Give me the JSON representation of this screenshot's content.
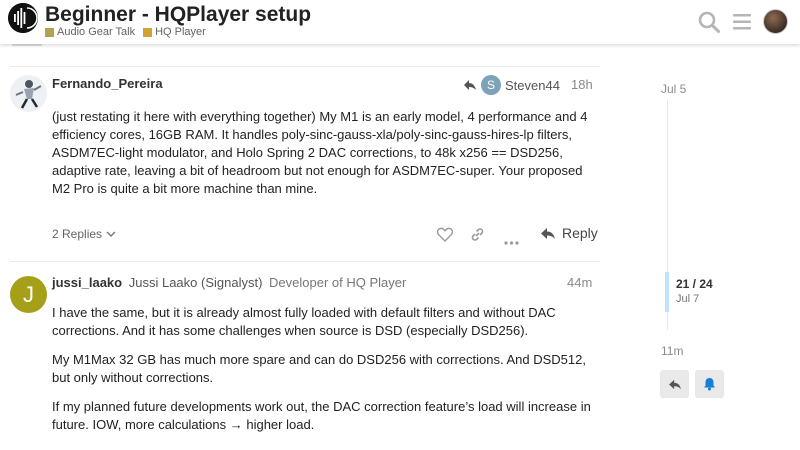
{
  "header": {
    "title": "Beginner - HQPlayer setup",
    "categories": [
      {
        "label": "Audio Gear Talk",
        "color": "#b3a44c"
      },
      {
        "label": "HQ Player",
        "color": "#d1a334"
      }
    ],
    "icons": [
      "search-icon",
      "hamburger-menu-icon",
      "user-avatar"
    ]
  },
  "posts": [
    {
      "username": "Fernando_Pereira",
      "reply_to_user": "Steven44",
      "reply_to_initial": "S",
      "reply_to_color": "#7ea2b7",
      "time": "18h",
      "paragraphs": [
        "(just restating it here with everything together) My M1 is an early model, 4 performance and 4 efficiency cores, 16GB RAM. It handles poly-sinc-gauss-xla/poly-sinc-gauss-hires-lp filters, ASDM7EC-light modulator, and Holo Spring 2 DAC corrections, to 48k x256 == DSD256, adaptive rate, leaving a bit of headroom but not enough for ASDM7EC-super. Your proposed M2 Pro is quite a bit more machine than mine."
      ],
      "replies_label": "2 Replies",
      "reply_label": "Reply"
    },
    {
      "username": "jussi_laako",
      "full_name": "Jussi Laako (Signalyst)",
      "user_title": "Developer of HQ Player",
      "avatar_initial": "J",
      "avatar_color": "#a6a018",
      "time": "44m",
      "paragraphs": [
        "I have the same, but it is already almost fully loaded with default filters and without DAC corrections. And it has some challenges when source is DSD (especially DSD256).",
        "My M1Max 32 GB has much more spare and can do DSD256 with corrections. And DSD512, but only without corrections.",
        "If my planned future developments work out, the DAC correction feature’s load will increase in future. IOW, more calculations → higher load."
      ]
    }
  ],
  "timeline": {
    "top_date": "Jul 5",
    "position": "21 / 24",
    "position_date": "Jul 7",
    "bottom_label": "11m"
  }
}
